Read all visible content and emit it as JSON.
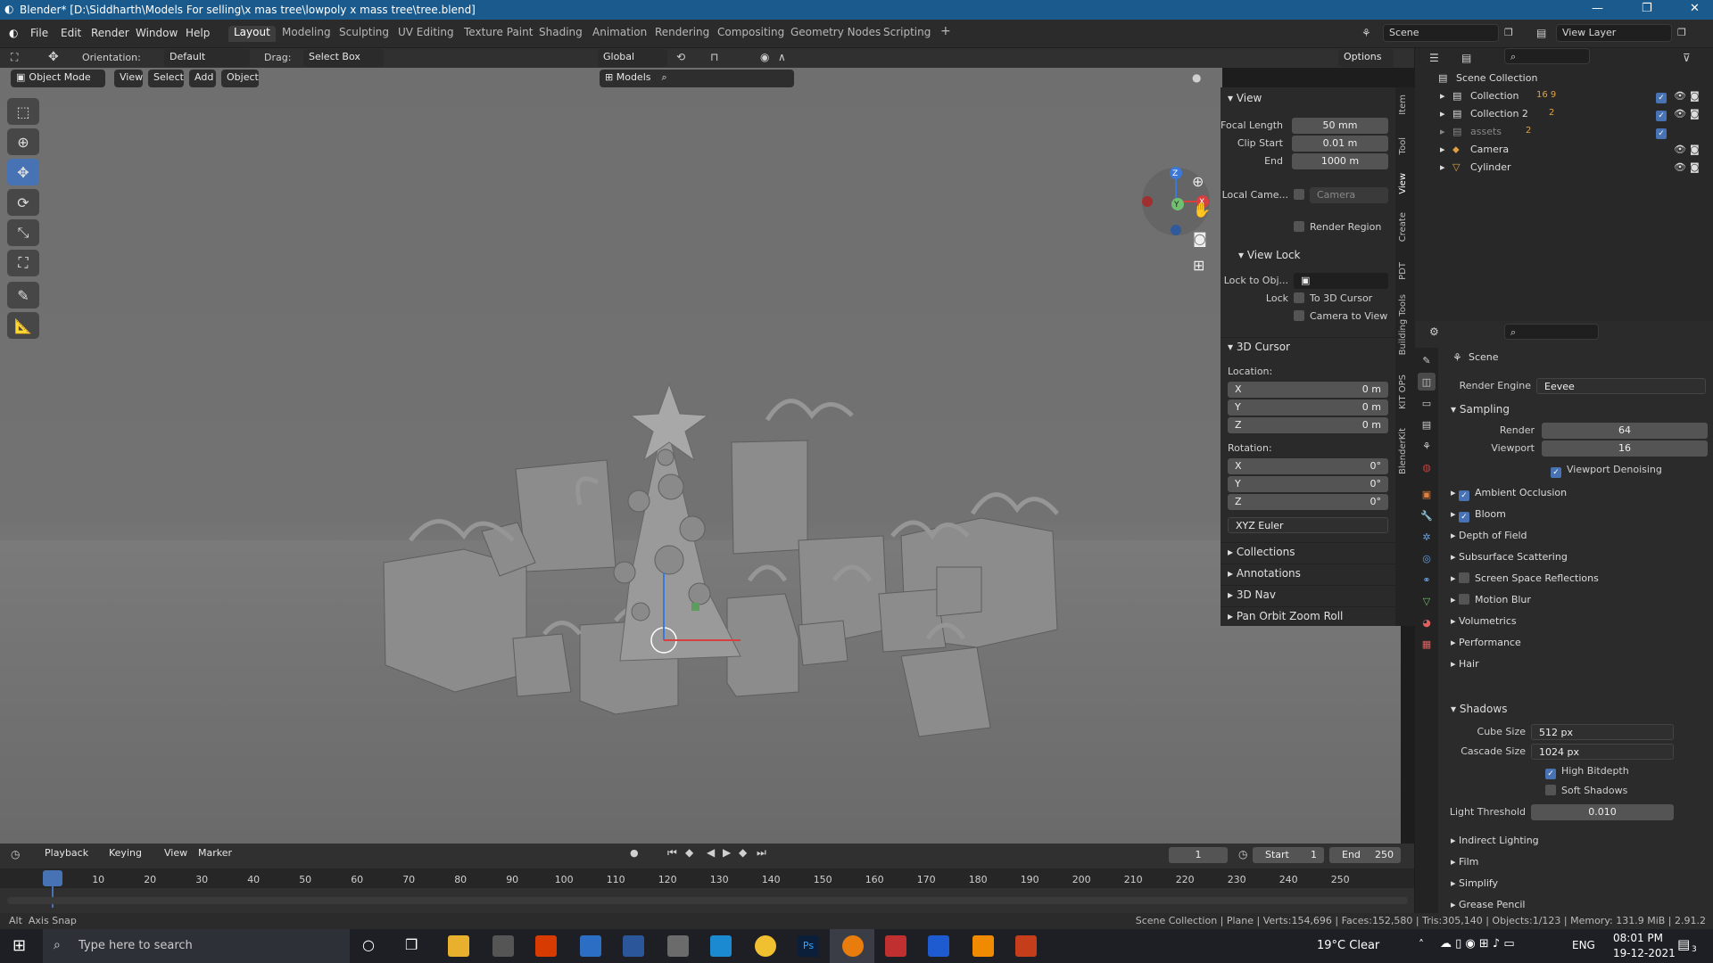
{
  "window": {
    "title": "Blender* [D:\\Siddharth\\Models For selling\\x mas tree\\lowpoly x mass tree\\tree.blend]"
  },
  "menu": [
    "File",
    "Edit",
    "Render",
    "Window",
    "Help"
  ],
  "workspaces": [
    "Layout",
    "Modeling",
    "Sculpting",
    "UV Editing",
    "Texture Paint",
    "Shading",
    "Animation",
    "Rendering",
    "Compositing",
    "Geometry Nodes",
    "Scripting"
  ],
  "active_workspace": "Layout",
  "scene_name": "Scene",
  "view_layer": "View Layer",
  "tool_header": {
    "orientation_label": "Orientation:",
    "orientation_value": "Default",
    "drag_label": "Drag:",
    "drag_value": "Select Box",
    "transform": "Global",
    "options": "Options"
  },
  "viewport_header": {
    "mode": "Object Mode",
    "menus": [
      "View",
      "Select",
      "Add",
      "Object"
    ],
    "collection_filter": "Models"
  },
  "n_panel": {
    "tabs": [
      "Item",
      "Tool",
      "View",
      "Create",
      "PDT",
      "Building Tools",
      "KIT OPS",
      "BlenderKit"
    ],
    "view": {
      "header": "View",
      "focal_length_label": "Focal Length",
      "focal_length": "50 mm",
      "clip_start_label": "Clip Start",
      "clip_start": "0.01 m",
      "end_label": "End",
      "end": "1000 m",
      "local_camera_label": "Local Came...",
      "local_camera": "Camera",
      "render_region": "Render Region"
    },
    "view_lock": {
      "header": "View Lock",
      "lock_to_obj_label": "Lock to Obj...",
      "lock_label": "Lock",
      "to_3d_cursor": "To 3D Cursor",
      "camera_to_view": "Camera to View"
    },
    "cursor": {
      "header": "3D Cursor",
      "location_label": "Location:",
      "rotation_label": "Rotation:",
      "loc": [
        {
          "axis": "X",
          "value": "0 m"
        },
        {
          "axis": "Y",
          "value": "0 m"
        },
        {
          "axis": "Z",
          "value": "0 m"
        }
      ],
      "rot": [
        {
          "axis": "X",
          "value": "0°"
        },
        {
          "axis": "Y",
          "value": "0°"
        },
        {
          "axis": "Z",
          "value": "0°"
        }
      ],
      "rotation_mode": "XYZ Euler"
    },
    "collapsed": [
      "Collections",
      "Annotations",
      "3D Nav",
      "Pan Orbit Zoom Roll"
    ]
  },
  "outliner": {
    "root": "Scene Collection",
    "items": [
      {
        "name": "Collection",
        "badge": "16 9"
      },
      {
        "name": "Collection 2",
        "badge": "2"
      },
      {
        "name": "assets",
        "badge": "2"
      },
      {
        "name": "Camera",
        "badge": ""
      },
      {
        "name": "Cylinder",
        "badge": ""
      }
    ]
  },
  "properties": {
    "context": "Scene",
    "render_engine_label": "Render Engine",
    "render_engine": "Eevee",
    "sampling": {
      "header": "Sampling",
      "render_label": "Render",
      "render": "64",
      "viewport_label": "Viewport",
      "viewport": "16",
      "denoise": "Viewport Denoising"
    },
    "panels": [
      {
        "label": "Ambient Occlusion",
        "check": true
      },
      {
        "label": "Bloom",
        "check": true
      },
      {
        "label": "Depth of Field",
        "check": null
      },
      {
        "label": "Subsurface Scattering",
        "check": null
      },
      {
        "label": "Screen Space Reflections",
        "check": false
      },
      {
        "label": "Motion Blur",
        "check": false
      },
      {
        "label": "Volumetrics",
        "check": null
      },
      {
        "label": "Performance",
        "check": null
      },
      {
        "label": "Hair",
        "check": null
      }
    ],
    "shadows": {
      "header": "Shadows",
      "cube_size_label": "Cube Size",
      "cube_size": "512 px",
      "cascade_size_label": "Cascade Size",
      "cascade_size": "1024 px",
      "high_bitdepth": "High Bitdepth",
      "soft_shadows": "Soft Shadows",
      "light_threshold_label": "Light Threshold",
      "light_threshold": "0.010"
    },
    "after": [
      "Indirect Lighting",
      "Film",
      "Simplify",
      "Grease Pencil"
    ]
  },
  "timeline": {
    "menus": [
      "Playback",
      "Keying",
      "View",
      "Marker"
    ],
    "current_frame": "1",
    "start_label": "Start",
    "start": "1",
    "end_label": "End",
    "end": "250",
    "ruler": [
      "1",
      "10",
      "20",
      "30",
      "40",
      "50",
      "60",
      "70",
      "80",
      "90",
      "100",
      "110",
      "120",
      "130",
      "140",
      "150",
      "160",
      "170",
      "180",
      "190",
      "200",
      "210",
      "220",
      "230",
      "240",
      "250"
    ]
  },
  "statusbar": {
    "left": "Axis Snap",
    "right": "Scene Collection | Plane | Verts:154,696 | Faces:152,580 | Tris:305,140 | Objects:1/123 | Memory: 131.9 MiB | 2.91.2"
  },
  "taskbar": {
    "search_placeholder": "Type here to search",
    "weather": "19°C  Clear",
    "lang": "ENG",
    "time": "08:01 PM",
    "date": "19-12-2021",
    "notifications": "3"
  },
  "gizmo": {
    "x": "X",
    "y": "Y",
    "z": "Z"
  }
}
